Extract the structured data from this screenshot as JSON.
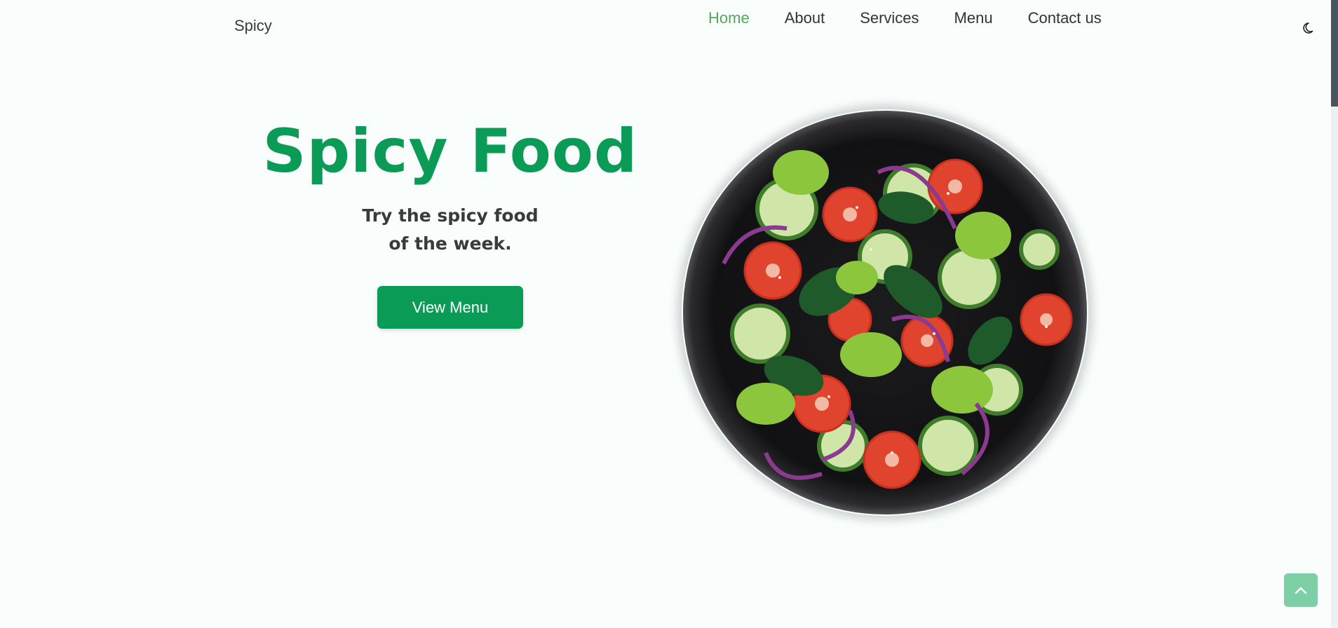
{
  "brand": {
    "logo": "Spicy"
  },
  "nav": {
    "items": [
      {
        "label": "Home",
        "active": true
      },
      {
        "label": "About",
        "active": false
      },
      {
        "label": "Services",
        "active": false
      },
      {
        "label": "Menu",
        "active": false
      },
      {
        "label": "Contact us",
        "active": false
      }
    ]
  },
  "icons": {
    "theme_toggle": "moon-icon",
    "scroll_top": "chevron-up-icon"
  },
  "hero": {
    "title": "Spicy Food",
    "subtitle": "Try the spicy food of the week.",
    "cta_label": "View Menu",
    "image": "salad-plate-image"
  },
  "colors": {
    "accent": "#0a9b57",
    "nav_active": "#55a85a",
    "scroll_top_bg": "#7dcfa5",
    "background": "#f9fdfc"
  }
}
